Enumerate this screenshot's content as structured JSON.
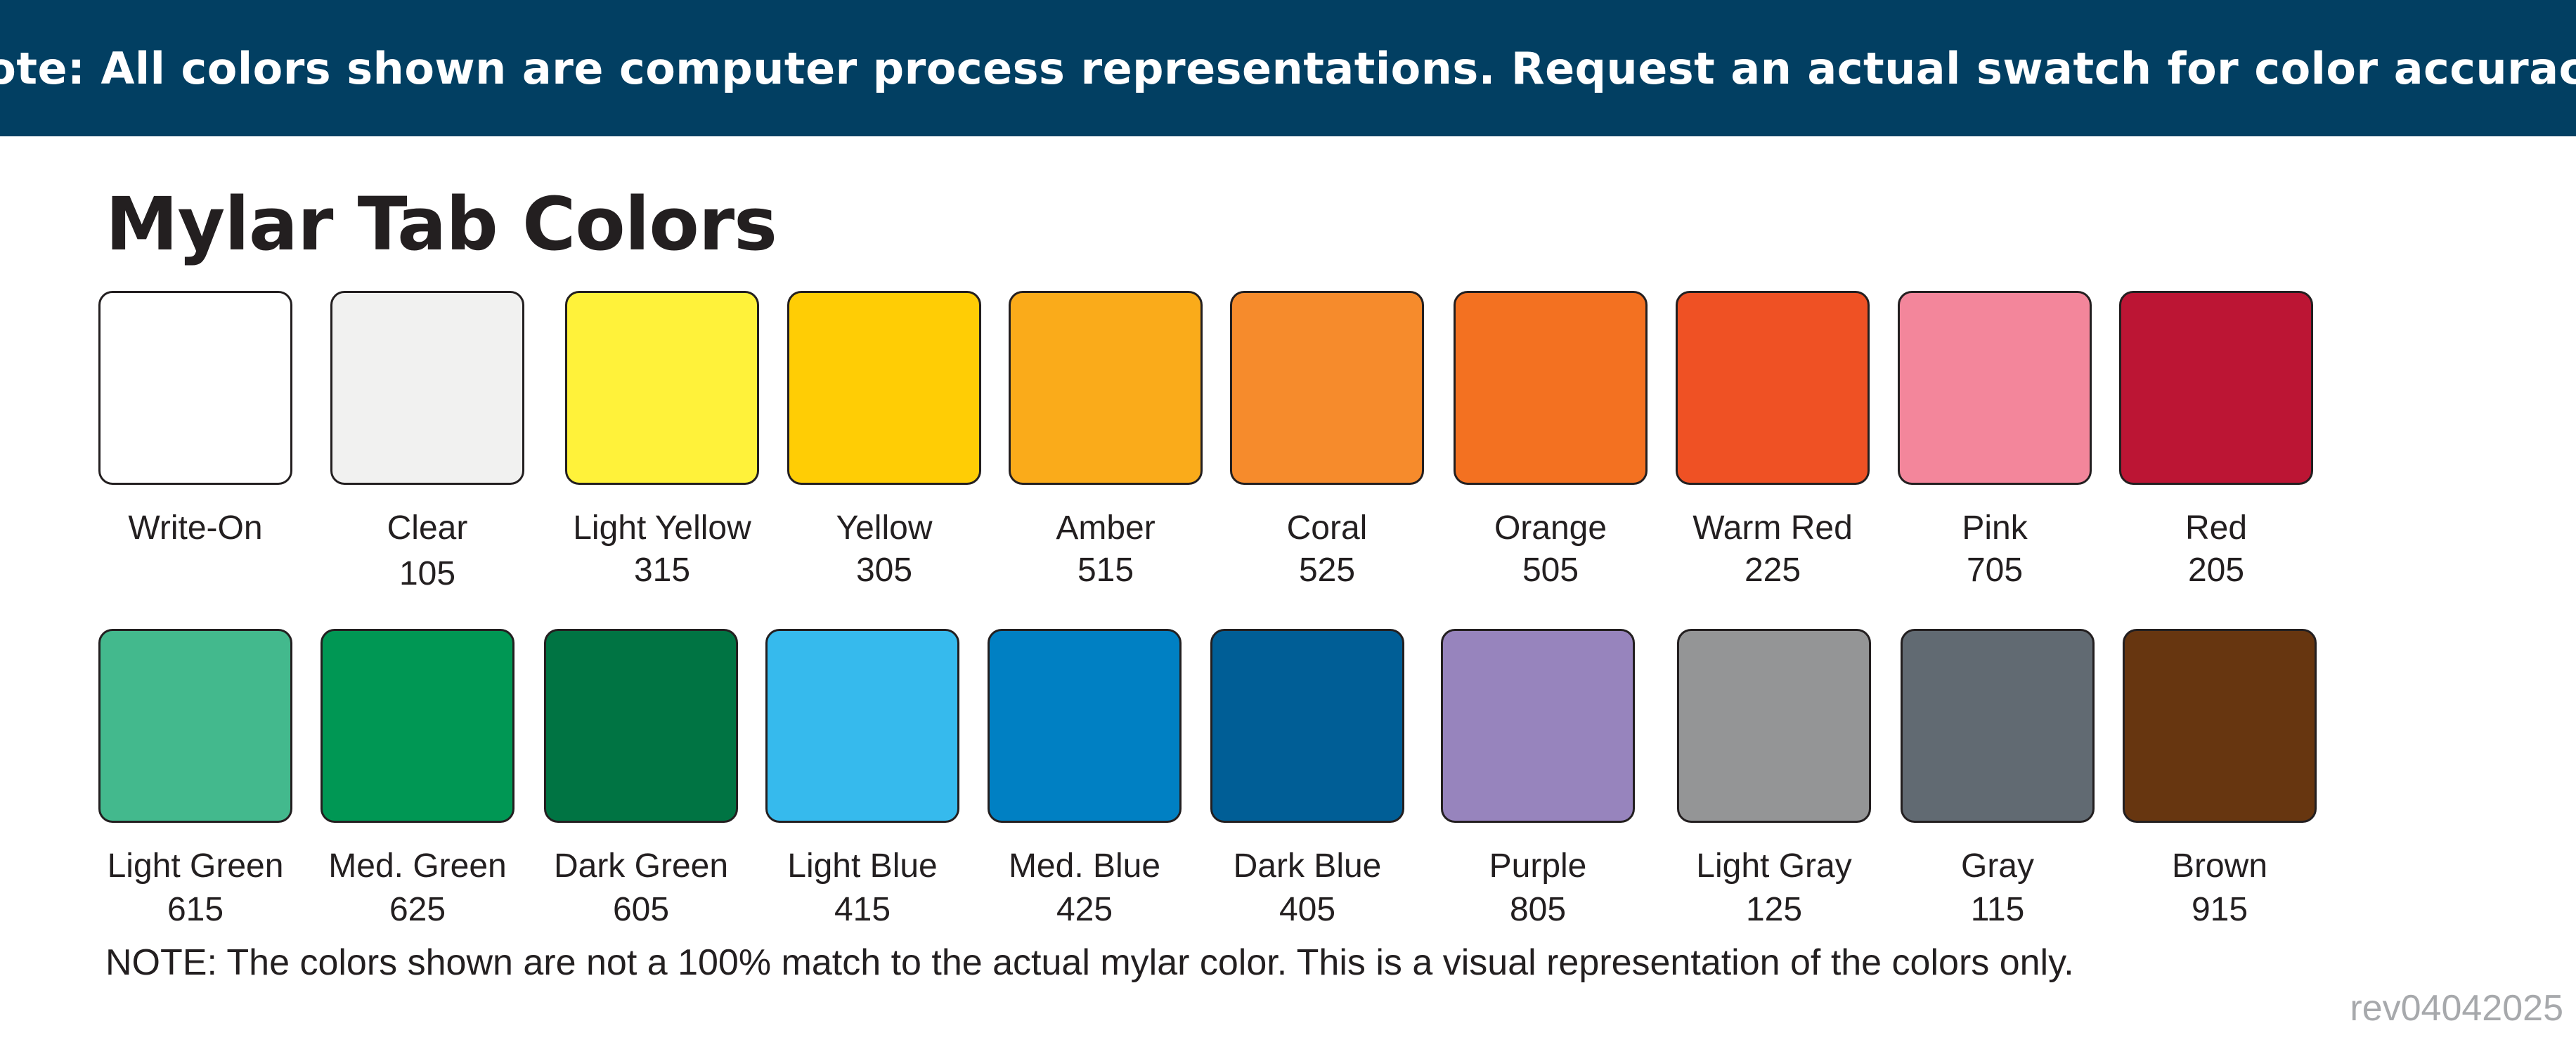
{
  "banner": {
    "text": "Note: All colors shown are computer process representations. Request an actual swatch for color accuracy.",
    "background": "#023f62"
  },
  "title": "Mylar Tab Colors",
  "rows": [
    [
      {
        "name": "Write-On",
        "code": "",
        "color": "#ffffff"
      },
      {
        "name": "Clear",
        "code": "105",
        "color": "#f1f1f0"
      },
      {
        "name": "Light Yellow",
        "code": "315",
        "color": "#fff23a"
      },
      {
        "name": "Yellow",
        "code": "305",
        "color": "#ffcd05"
      },
      {
        "name": "Amber",
        "code": "515",
        "color": "#faab1a"
      },
      {
        "name": "Coral",
        "code": "525",
        "color": "#f68b2c"
      },
      {
        "name": "Orange",
        "code": "505",
        "color": "#f37121"
      },
      {
        "name": "Warm Red",
        "code": "225",
        "color": "#ef5124"
      },
      {
        "name": "Pink",
        "code": "705",
        "color": "#f3869b"
      },
      {
        "name": "Red",
        "code": "205",
        "color": "#bc1534"
      }
    ],
    [
      {
        "name": "Light Green",
        "code": "615",
        "color": "#43b98d"
      },
      {
        "name": "Med. Green",
        "code": "625",
        "color": "#009754"
      },
      {
        "name": "Dark Green",
        "code": "605",
        "color": "#007443"
      },
      {
        "name": "Light Blue",
        "code": "415",
        "color": "#36baed"
      },
      {
        "name": "Med. Blue",
        "code": "425",
        "color": "#0080c3"
      },
      {
        "name": "Dark Blue",
        "code": "405",
        "color": "#005e96"
      },
      {
        "name": "Purple",
        "code": "805",
        "color": "#9784bd"
      },
      {
        "name": "Light Gray",
        "code": "125",
        "color": "#949596"
      },
      {
        "name": "Gray",
        "code": "115",
        "color": "#616a72"
      },
      {
        "name": "Brown",
        "code": "915",
        "color": "#673610"
      }
    ]
  ],
  "footnote": "NOTE: The colors shown are not a 100% match to the actual mylar color. This is a visual representation of the colors only.",
  "revision": "rev04042025"
}
